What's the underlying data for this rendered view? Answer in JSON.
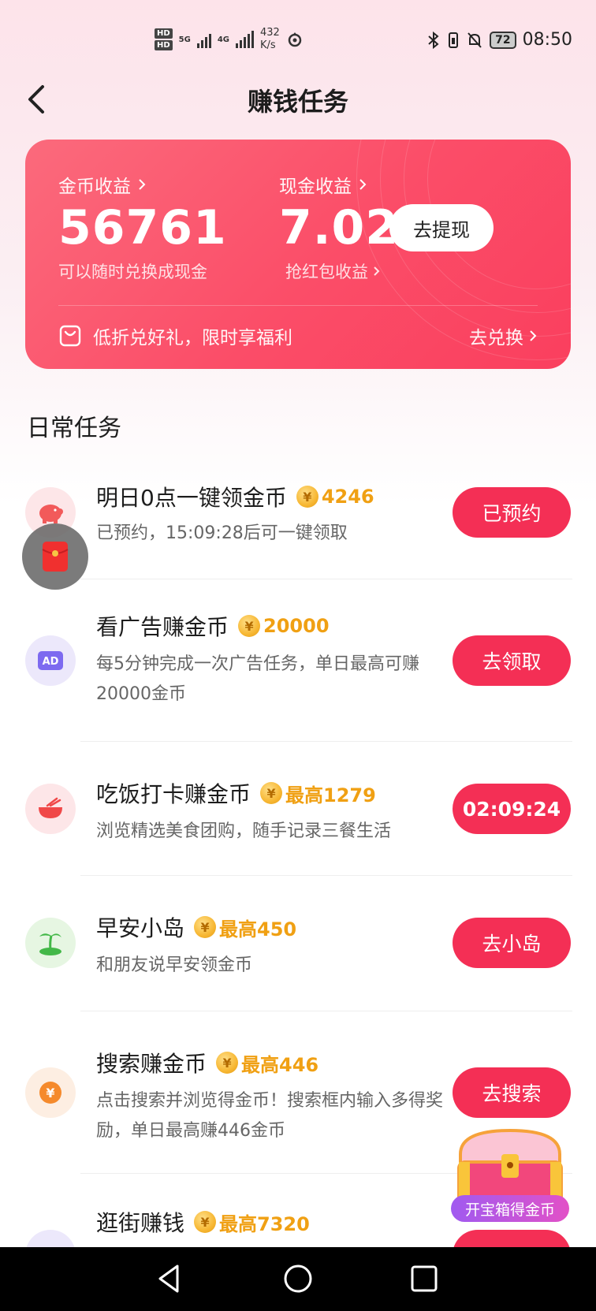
{
  "status_bar": {
    "hd1": "HD",
    "hd2": "HD",
    "sim1_net": "5G",
    "sim2_net": "4G",
    "speed_value": "432",
    "speed_unit": "K/s",
    "battery": "72",
    "time": "08:50",
    "icons": [
      "bluetooth-icon",
      "vibrate-icon",
      "mute-icon",
      "battery-icon"
    ]
  },
  "header": {
    "title": "赚钱任务",
    "back_icon": "chevron-left-icon"
  },
  "earnings": {
    "coin_label": "金币收益",
    "coin_value": "56761",
    "coin_sub": "可以随时兑换成现金",
    "cash_label": "现金收益",
    "cash_value": "7.02",
    "cash_sub": "抢红包收益",
    "withdraw_label": "去提现",
    "promo_text": "低折兑好礼，限时享福利",
    "exchange_label": "去兑换"
  },
  "section_title": "日常任务",
  "tasks": [
    {
      "title": "明日0点一键领金币",
      "reward": "4246",
      "desc": "已预约，15:09:28后可一键领取",
      "button": "已预约",
      "icon": "piggy-bank-icon",
      "icon_bg": "#fde6e8",
      "icon_color": "#f25a5a"
    },
    {
      "title": "看广告赚金币",
      "reward": "20000",
      "desc": "每5分钟完成一次广告任务，单日最高可赚20000金币",
      "button": "去领取",
      "icon": "ad-icon",
      "icon_bg": "#ece8fb",
      "icon_color": "#7d6af0"
    },
    {
      "title": "吃饭打卡赚金币",
      "reward": "最高1279",
      "desc": "浏览精选美食团购，随手记录三餐生活",
      "button": "02:09:24",
      "icon": "food-bowl-icon",
      "icon_bg": "#fde6e8",
      "icon_color": "#f04848"
    },
    {
      "title": "早安小岛",
      "reward": "最高450",
      "desc": "和朋友说早安领金币",
      "button": "去小岛",
      "icon": "island-palm-icon",
      "icon_bg": "#e6f6e2",
      "icon_color": "#43b848"
    },
    {
      "title": "搜索赚金币",
      "reward": "最高446",
      "desc": "点击搜索并浏览得金币！搜索框内输入多得奖励，单日最高赚446金币",
      "button": "去搜索",
      "icon": "yuan-coin-icon",
      "icon_bg": "#fdeee2",
      "icon_color": "#f58a2c"
    },
    {
      "title": "逛街赚钱",
      "reward": "最高7320",
      "desc": "",
      "button": "",
      "icon": "shopping-bag-icon",
      "icon_bg": "#ece8fb",
      "icon_color": "#8a52e8"
    }
  ],
  "floating": {
    "red_packet_icon": "red-packet-icon",
    "chest_icon": "treasure-chest-icon",
    "chest_label": "开宝箱得金币"
  },
  "nav": [
    "back-triangle-icon",
    "home-circle-icon",
    "recents-square-icon"
  ]
}
